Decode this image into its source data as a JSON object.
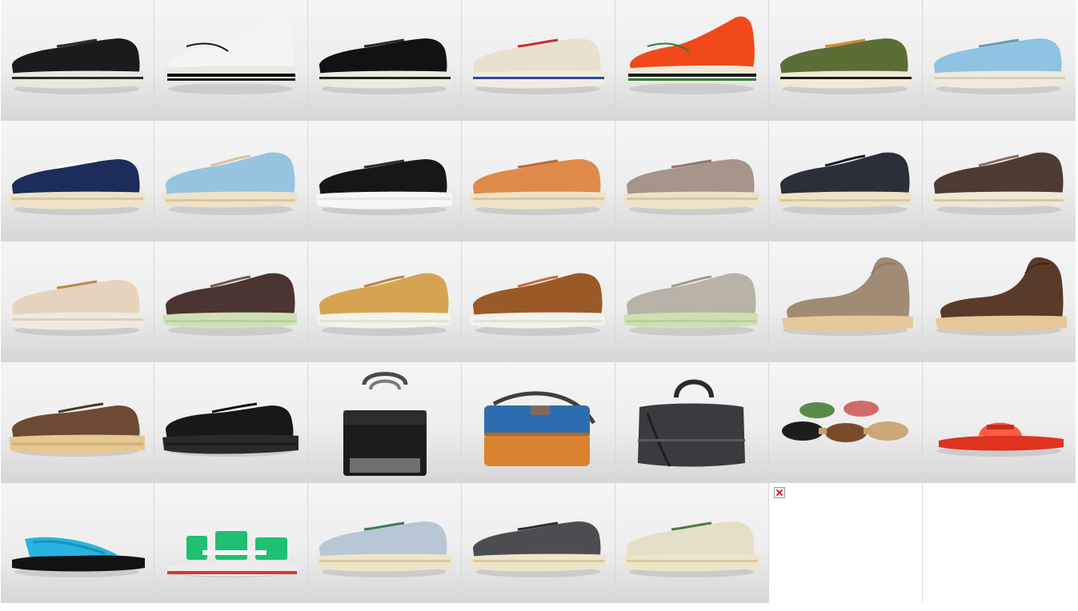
{
  "gallery": {
    "items": [
      {
        "kind": "low",
        "upper": "#1b1b1d",
        "sole": "#e9e7df",
        "accent": "#2a2a2a",
        "stripe": "#2a2a2a"
      },
      {
        "kind": "high",
        "upper": "#f4f4f2",
        "sole": "#eae8e2",
        "accent": "#1a1a1a",
        "stripe": "#111111"
      },
      {
        "kind": "low",
        "upper": "#121214",
        "sole": "#ece9df",
        "accent": "#2b2b2b",
        "stripe": "#222222"
      },
      {
        "kind": "low",
        "upper": "#e9e1cf",
        "sole": "#f0ece0",
        "accent": "#c53030",
        "stripe": "#2b4aa0"
      },
      {
        "kind": "high",
        "upper": "#f04a1a",
        "sole": "#efe9d8",
        "accent": "#2f7a3a",
        "stripe": "#1c1c1c"
      },
      {
        "kind": "low",
        "upper": "#5b6e36",
        "sole": "#efe9d8",
        "accent": "#d9862a",
        "stripe": "#1c1c1c"
      },
      {
        "kind": "low",
        "upper": "#8fc3e3",
        "sole": "#efeadc",
        "accent": "#6f98b3",
        "stripe": "#d6d0c2"
      },
      {
        "kind": "low",
        "upper": "#1c2d5c",
        "sole": "#eee3c7",
        "accent": "#ffffff",
        "stripe": "#d6c9a4"
      },
      {
        "kind": "mid",
        "upper": "#97c4e0",
        "sole": "#eee3c7",
        "accent": "#d8c39a",
        "stripe": "#d6c9a4"
      },
      {
        "kind": "low",
        "upper": "#17171a",
        "sole": "#f6f6f4",
        "accent": "#2c2c2c",
        "stripe": "#e6e6e6"
      },
      {
        "kind": "low",
        "upper": "#df8a4a",
        "sole": "#eee3c7",
        "accent": "#b96a30",
        "stripe": "#d6c9a4"
      },
      {
        "kind": "low",
        "upper": "#a7948a",
        "sole": "#eee3c7",
        "accent": "#8b786e",
        "stripe": "#d6c9a4"
      },
      {
        "kind": "mid",
        "upper": "#2a2f3a",
        "sole": "#eee3c7",
        "accent": "#1a1d24",
        "stripe": "#d6c9a4"
      },
      {
        "kind": "mid",
        "upper": "#4e3b32",
        "sole": "#eee8d6",
        "accent": "#8e6a57",
        "stripe": "#d6c9a4"
      },
      {
        "kind": "low",
        "upper": "#e5d3bd",
        "sole": "#efeadf",
        "accent": "#b98848",
        "stripe": "#d8d2c2"
      },
      {
        "kind": "mid",
        "upper": "#4b3530",
        "sole": "#cfe0b8",
        "accent": "#6c5a50",
        "stripe": "#b9cf9e"
      },
      {
        "kind": "mid",
        "upper": "#d6a451",
        "sole": "#f4f2ec",
        "accent": "#b98538",
        "stripe": "#e5e1d6"
      },
      {
        "kind": "mid",
        "upper": "#9a5a28",
        "sole": "#f4f2ec",
        "accent": "#c76b32",
        "stripe": "#e5e1d6"
      },
      {
        "kind": "mid",
        "upper": "#b8b3a6",
        "sole": "#cfe0b0",
        "accent": "#9e998c",
        "stripe": "#b9cf9e"
      },
      {
        "kind": "boot",
        "upper": "#a08c75",
        "sole": "#e6c89b",
        "accent": "#8a7862",
        "stripe": "#d8b585"
      },
      {
        "kind": "boot",
        "upper": "#5a3a28",
        "sole": "#e6c89b",
        "accent": "#3f271b",
        "stripe": "#d8b585"
      },
      {
        "kind": "derby",
        "upper": "#6e4a34",
        "sole": "#e6c892",
        "accent": "#4f3221",
        "stripe": "#d3b27b"
      },
      {
        "kind": "derby",
        "upper": "#18181b",
        "sole": "#2a2a2d",
        "accent": "#0f0f11",
        "stripe": "#1d1d20"
      },
      {
        "kind": "tote",
        "upper": "#1c1c1e",
        "sole": "#6f6f6f",
        "accent": "#4a4a4a",
        "stripe": "#7a7a7a"
      },
      {
        "kind": "messenger",
        "upper": "#2d6db0",
        "sole": "#d9822f",
        "accent": "#b36a25",
        "stripe": "#3f3f3f"
      },
      {
        "kind": "duffel",
        "upper": "#3a3a3f",
        "sole": "#1e1e22",
        "accent": "#5a5a60",
        "stripe": "#2a2a2f"
      },
      {
        "kind": "belts",
        "upper": "#7a4b2a",
        "sole": "#1d1d1d",
        "accent": "#c9a06a",
        "stripe": "#5a8a4a"
      },
      {
        "kind": "slide",
        "upper": "#e0321f",
        "sole": "#e0321f",
        "accent": "#ff5a44",
        "stripe": "#b7220f"
      },
      {
        "kind": "flipflop",
        "upper": "#27b4df",
        "sole": "#121214",
        "accent": "#1c8fb8",
        "stripe": "#2c2c30"
      },
      {
        "kind": "sandal",
        "upper": "#1fbf74",
        "sole": "#ececec",
        "accent": "#d9382a",
        "stripe": "#f4f4f4"
      },
      {
        "kind": "low",
        "upper": "#b8c7d6",
        "sole": "#efe5c8",
        "accent": "#3d7a52",
        "stripe": "#d9caa3"
      },
      {
        "kind": "low",
        "upper": "#4b4d50",
        "sole": "#efe5c8",
        "accent": "#2b2d30",
        "stripe": "#d9caa3"
      },
      {
        "kind": "low",
        "upper": "#e4e0c8",
        "sole": "#efe5c8",
        "accent": "#4e7a3a",
        "stripe": "#d9caa3"
      },
      {
        "kind": "broken"
      },
      {
        "kind": "empty"
      }
    ]
  }
}
